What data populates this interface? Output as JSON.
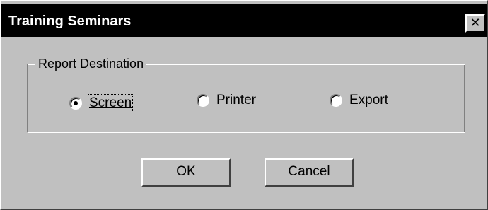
{
  "window": {
    "title": "Training Seminars",
    "close_glyph": "✕"
  },
  "report_destination": {
    "legend": "Report Destination",
    "options": [
      {
        "label": "Screen",
        "selected": true
      },
      {
        "label": "Printer",
        "selected": false
      },
      {
        "label": "Export",
        "selected": false
      }
    ]
  },
  "buttons": {
    "ok_label": "OK",
    "cancel_label": "Cancel"
  }
}
